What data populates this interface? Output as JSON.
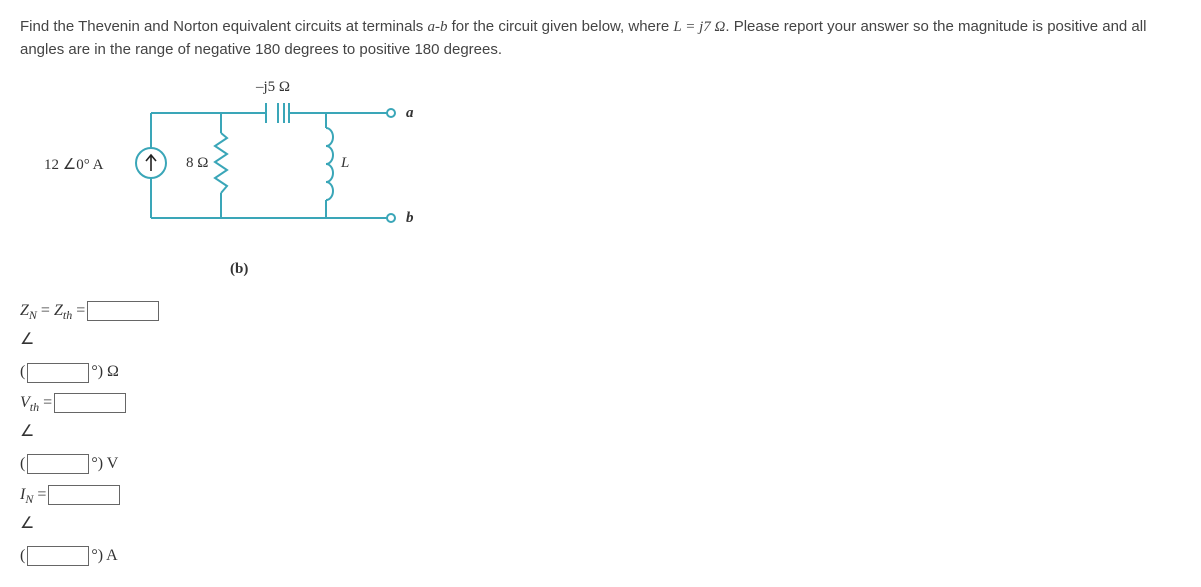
{
  "problem": {
    "text_prefix": "Find the Thevenin and Norton equivalent circuits at terminals ",
    "ab": "a-b",
    "text_mid": " for the circuit given below, where ",
    "L_eq": "L = j7 Ω",
    "text_after_L": ". Please report your answer so the magnitude is positive and all angles are in the range of negative 180 degrees to positive 180 degrees."
  },
  "circuit": {
    "cap_label": "–j5 Ω",
    "source_label": "12 ∠0° A",
    "resistor_label": "8 Ω",
    "inductor_label": "L",
    "terminal_a": "a",
    "terminal_b": "b",
    "caption": "(b)"
  },
  "answers": {
    "zn_label": "ZN = Zth =",
    "zn_angle_sym": "∠",
    "zn_unit": "°) Ω",
    "vth_label": "Vth =",
    "vth_angle_sym": "∠",
    "vth_unit": "°) V",
    "in_label": "IN =",
    "in_angle_sym": "∠",
    "in_unit": "°) A",
    "paren": "("
  }
}
